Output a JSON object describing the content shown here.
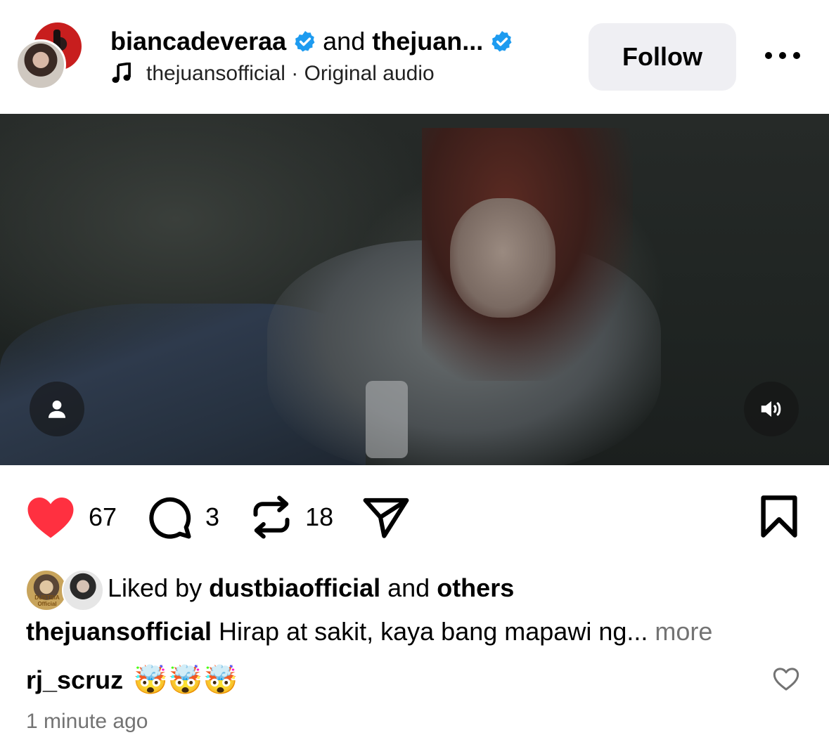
{
  "header": {
    "user1": "biancadeveraa",
    "conjunction": "and",
    "user2": "thejuan...",
    "audio_owner": "thejuansofficial",
    "audio_separator": " · ",
    "audio_label": "Original audio",
    "follow_label": "Follow"
  },
  "actions": {
    "likes": "67",
    "comments": "3",
    "reposts": "18"
  },
  "liked_by": {
    "prefix": "Liked by ",
    "user": "dustbiaofficial",
    "middle": " and ",
    "others": "others",
    "avatar1_text": "DUSTBIA Official"
  },
  "caption": {
    "user": "thejuansofficial",
    "text": " Hirap at sakit, kaya bang mapawi ng...",
    "more": " more"
  },
  "comment": {
    "user": "rj_scruz",
    "emoji": "🤯🤯🤯"
  },
  "timestamp": "1 minute ago",
  "colors": {
    "like_red": "#ff3040",
    "verified_blue": "#1d9bf0",
    "follow_bg": "#efeff3",
    "muted_text": "#737373"
  },
  "icons": [
    "heart-icon",
    "comment-icon",
    "repost-icon",
    "share-icon",
    "bookmark-icon",
    "music-note-icon",
    "verified-icon",
    "more-icon",
    "user-tag-icon",
    "volume-icon"
  ]
}
